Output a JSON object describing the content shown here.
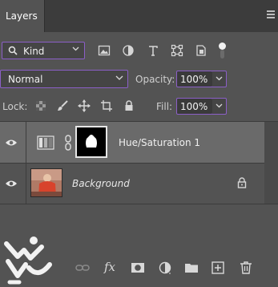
{
  "panel": {
    "tab_title": "Layers"
  },
  "filter": {
    "kind_label": "Kind"
  },
  "blend": {
    "mode": "Normal",
    "opacity_label": "Opacity:",
    "opacity_value": "100%"
  },
  "lock": {
    "label": "Lock:",
    "fill_label": "Fill:",
    "fill_value": "100%"
  },
  "layers": [
    {
      "name": "Hue/Saturation 1",
      "selected": true,
      "visible": true
    },
    {
      "name": "Background",
      "selected": false,
      "visible": true,
      "locked": true
    }
  ],
  "bottom_bar": {
    "fx_label": "fx"
  },
  "colors": {
    "accent": "#8b5fc7",
    "panel_bg": "#535353",
    "selected_row": "#6a6a6a"
  }
}
